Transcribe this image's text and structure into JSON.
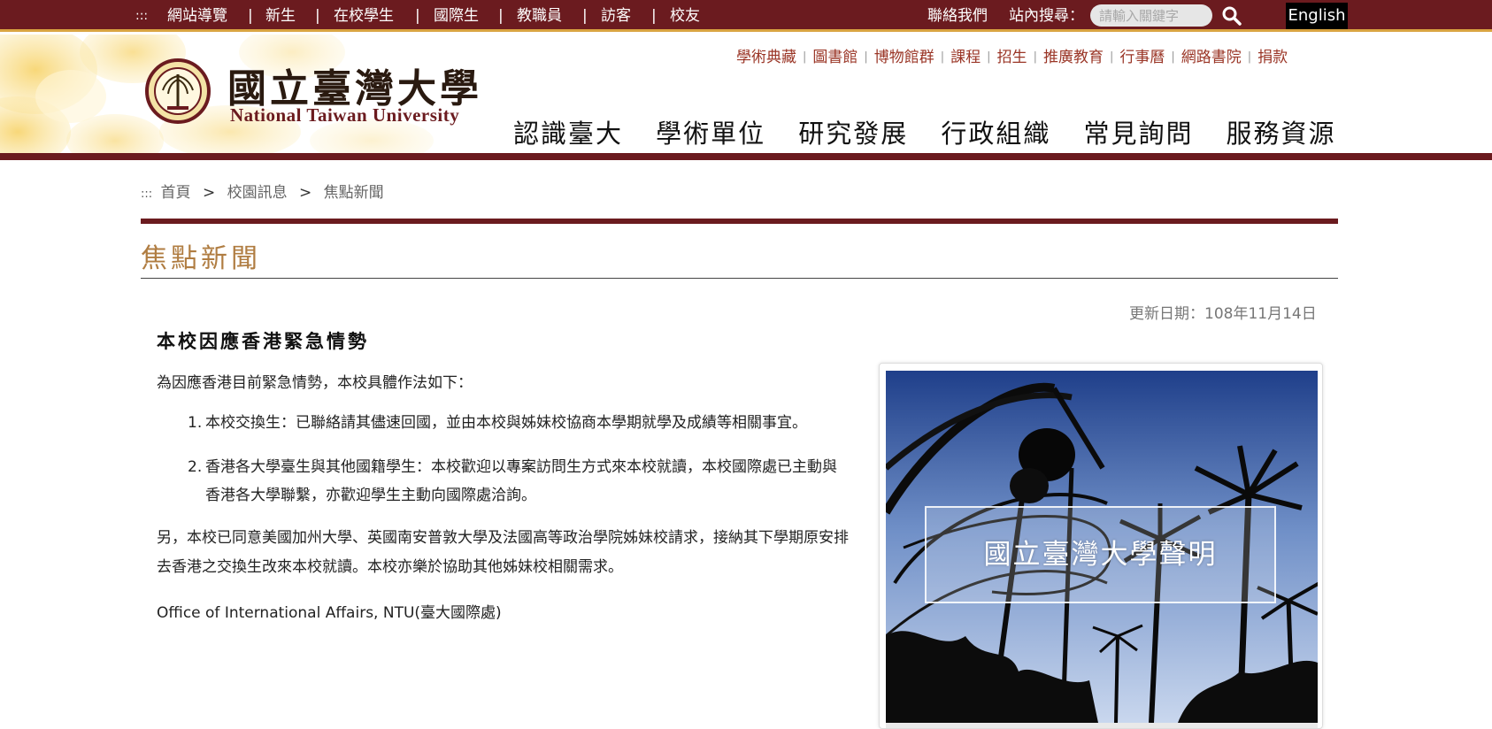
{
  "top_bar": {
    "menu_icon_text": ":::",
    "links": [
      "網站導覽",
      "新生",
      "在校學生",
      "國際生",
      "教職員",
      "訪客",
      "校友"
    ],
    "contact": "聯絡我們",
    "search_label": "站內搜尋：",
    "search_placeholder": "請輸入關鍵字",
    "english": "English"
  },
  "header": {
    "logo_cn": "國立臺灣大學",
    "logo_en": "National Taiwan University",
    "quick_links": [
      "學術典藏",
      "圖書館",
      "博物館群",
      "課程",
      "招生",
      "推廣教育",
      "行事曆",
      "網路書院",
      "捐款"
    ],
    "main_nav": [
      "認識臺大",
      "學術單位",
      "研究發展",
      "行政組織",
      "常見詢問",
      "服務資源"
    ]
  },
  "breadcrumb": {
    "prefix": ":::",
    "items": [
      "首頁",
      "校園訊息",
      "焦點新聞"
    ],
    "separator": ">"
  },
  "page": {
    "title": "焦點新聞",
    "update_date": "更新日期：108年11月14日"
  },
  "article": {
    "title": "本校因應香港緊急情勢",
    "intro": "為因應香港目前緊急情勢，本校具體作法如下：",
    "items": [
      {
        "num": "1.",
        "text": "本校交換生：已聯絡請其儘速回國，並由本校與姊妹校協商本學期就學及成績等相關事宜。"
      },
      {
        "num": "2.",
        "text": "香港各大學臺生與其他國籍學生：本校歡迎以專案訪問生方式來本校就讀，本校國際處已主動與香港各大學聯繫，亦歡迎學生主動向國際處洽詢。"
      }
    ],
    "other": "另，本校已同意美國加州大學、英國南安普敦大學及法國高等政治學院姊妹校請求，接納其下學期原安排去香港之交換生改來本校就讀。本校亦樂於協助其他姊妹校相關需求。",
    "office": "Office of International Affairs, NTU(臺大國際處)"
  },
  "card": {
    "label": "國立臺灣大學聲明"
  },
  "colors": {
    "brand_maroon": "#6b1b1f",
    "gold_accent": "#d9a441",
    "title_gold": "#b07d42"
  }
}
